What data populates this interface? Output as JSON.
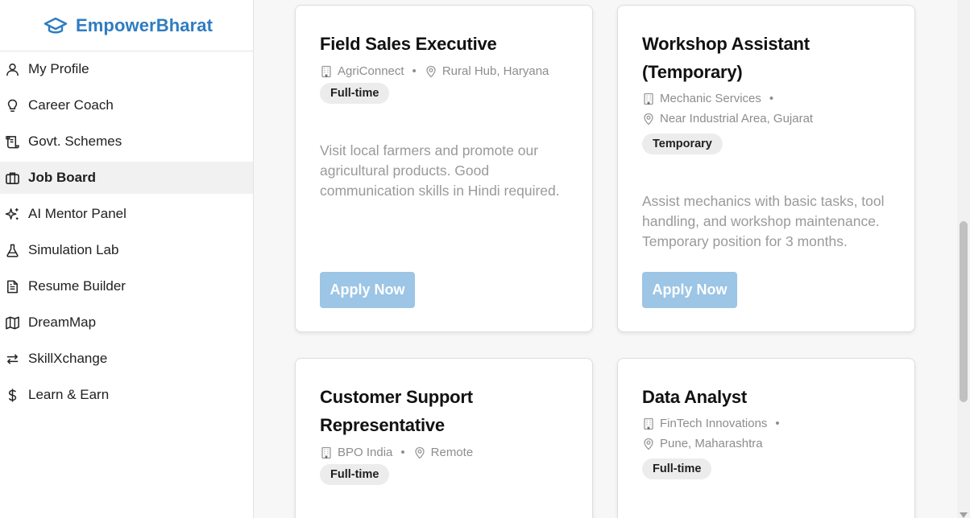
{
  "brand": {
    "name": "EmpowerBharat",
    "icon": "graduation-cap-icon",
    "color": "#2f7cc1"
  },
  "nav": [
    {
      "label": "My Profile",
      "icon": "user-icon"
    },
    {
      "label": "Career Coach",
      "icon": "lightbulb-icon"
    },
    {
      "label": "Govt. Schemes",
      "icon": "scroll-icon"
    },
    {
      "label": "Job Board",
      "icon": "briefcase-icon",
      "active": true
    },
    {
      "label": "AI Mentor Panel",
      "icon": "sparkles-icon"
    },
    {
      "label": "Simulation Lab",
      "icon": "flask-icon"
    },
    {
      "label": "Resume Builder",
      "icon": "file-text-icon"
    },
    {
      "label": "DreamMap",
      "icon": "map-icon"
    },
    {
      "label": "SkillXchange",
      "icon": "repeat-icon"
    },
    {
      "label": "Learn & Earn",
      "icon": "dollar-icon"
    }
  ],
  "jobs": [
    {
      "title": "Field Sales Executive",
      "company": "AgriConnect",
      "location": "Rural Hub, Haryana",
      "type": "Full-time",
      "description": "Visit local farmers and promote our agricultural products. Good communication skills in Hindi required.",
      "apply_label": "Apply Now"
    },
    {
      "title": "Workshop Assistant (Temporary)",
      "company": "Mechanic Services",
      "location": "Near Industrial Area, Gujarat",
      "type": "Temporary",
      "description": "Assist mechanics with basic tasks, tool handling, and workshop maintenance. Temporary position for 3 months.",
      "apply_label": "Apply Now"
    },
    {
      "title": "Customer Support Representative",
      "company": "BPO India",
      "location": "Remote",
      "type": "Full-time"
    },
    {
      "title": "Data Analyst",
      "company": "FinTech Innovations",
      "location": "Pune, Maharashtra",
      "type": "Full-time"
    }
  ],
  "colors": {
    "apply_button": "#9cc5e6",
    "tag_bg": "#ececec"
  }
}
